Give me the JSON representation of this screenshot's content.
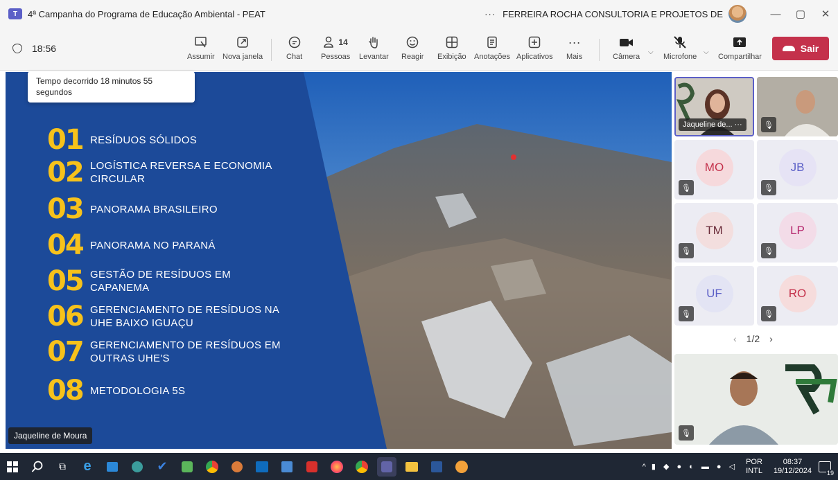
{
  "window": {
    "title": "4ª Campanha do Programa de Educação Ambiental - PEAT",
    "more": "···",
    "org": "FERREIRA ROCHA CONSULTORIA E PROJETOS DE",
    "minimize": "—",
    "maximize": "▢",
    "close": "✕"
  },
  "toolbar": {
    "timer": "18:56",
    "items": [
      {
        "label": "Assumir",
        "icon": "take-control-icon"
      },
      {
        "label": "Nova janela",
        "icon": "pop-out-icon"
      },
      {
        "label": "Chat",
        "icon": "chat-icon"
      },
      {
        "label": "Pessoas",
        "icon": "people-icon",
        "count": "14"
      },
      {
        "label": "Levantar",
        "icon": "raise-hand-icon"
      },
      {
        "label": "Reagir",
        "icon": "react-icon"
      },
      {
        "label": "Exibição",
        "icon": "view-icon"
      },
      {
        "label": "Anotações",
        "icon": "notes-icon"
      },
      {
        "label": "Aplicativos",
        "icon": "apps-icon"
      },
      {
        "label": "Mais",
        "icon": "more-icon"
      },
      {
        "label": "Câmera",
        "icon": "camera-icon"
      },
      {
        "label": "Microfone",
        "icon": "microphone-off-icon"
      },
      {
        "label": "Compartilhar",
        "icon": "share-icon"
      }
    ],
    "leave_label": "Sair",
    "leave_color": "#c4314b"
  },
  "tooltip": {
    "text": "Tempo decorrido 18 minutos 55 segundos"
  },
  "slide": {
    "accent": "#f7c21b",
    "background": "#1c4a99",
    "items": [
      {
        "num": "01",
        "text": "RESÍDUOS SÓLIDOS"
      },
      {
        "num": "02",
        "text": "LOGÍSTICA REVERSA E ECONOMIA CIRCULAR"
      },
      {
        "num": "03",
        "text": "PANORAMA BRASILEIRO"
      },
      {
        "num": "04",
        "text": "PANORAMA NO PARANÁ"
      },
      {
        "num": "05",
        "text": "GESTÃO DE RESÍDUOS EM CAPANEMA"
      },
      {
        "num": "06",
        "text": "GERENCIAMENTO DE RESÍDUOS NA UHE BAIXO IGUAÇU"
      },
      {
        "num": "07",
        "text": "GERENCIAMENTO DE RESÍDUOS EM OUTRAS UHE'S"
      },
      {
        "num": "08",
        "text": "METODOLOGIA 5S"
      }
    ],
    "presenter": "Jaqueline de Moura"
  },
  "gallery": {
    "active_name": "Jaqueline de...",
    "participants": [
      {
        "initials": "MO",
        "color": "#c4314b",
        "bg": "#f6d9dc"
      },
      {
        "initials": "JB",
        "color": "#5b5fc7",
        "bg": "#e6e3f5"
      },
      {
        "initials": "TM",
        "color": "#6b2d3b",
        "bg": "#f3dede"
      },
      {
        "initials": "LP",
        "color": "#b4246b",
        "bg": "#f3dce8"
      },
      {
        "initials": "UF",
        "color": "#5b5fc7",
        "bg": "#e3e4f4"
      },
      {
        "initials": "RO",
        "color": "#c4314b",
        "bg": "#f6dcdc"
      }
    ],
    "pager": "1/2",
    "prev": "‹",
    "next": "›"
  },
  "taskbar": {
    "lang_top": "POR",
    "lang_bottom": "INTL",
    "time": "08:37",
    "date": "19/12/2024",
    "notifications": "19"
  }
}
